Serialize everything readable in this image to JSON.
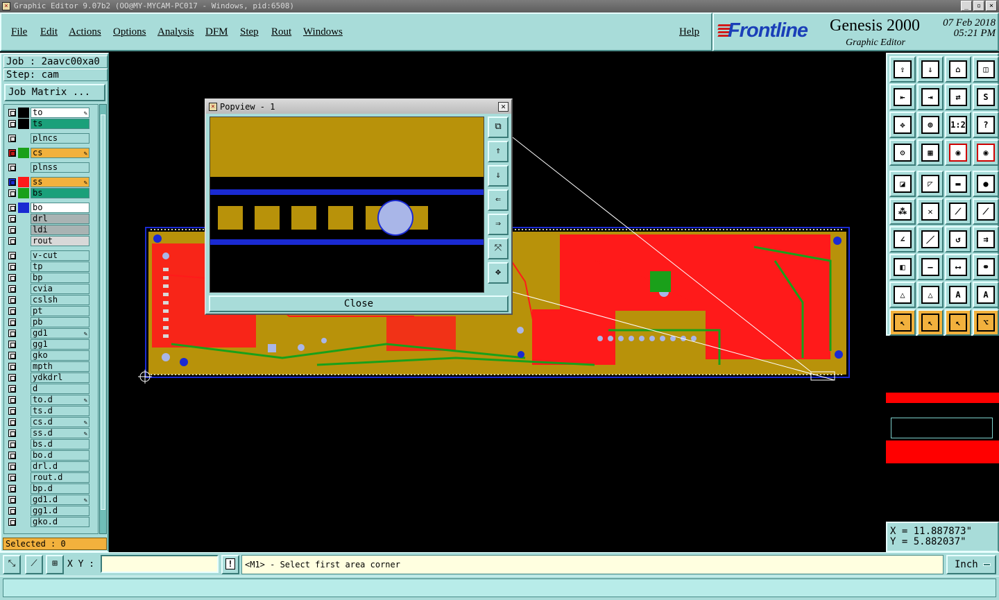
{
  "window": {
    "title": "Graphic Editor 9.07b2 (OO@MY-MYCAM-PC017 - Windows, pid:6508)",
    "controls": [
      "_",
      "▫",
      "×"
    ]
  },
  "menu": {
    "items": [
      "File",
      "Edit",
      "Actions",
      "Options",
      "Analysis",
      "DFM",
      "Step",
      "Rout",
      "Windows"
    ],
    "help": "Help"
  },
  "brand": {
    "logo": "Frontline",
    "product": "Genesis 2000",
    "subtitle": "Graphic Editor",
    "date": "07 Feb 2018",
    "time": "05:21 PM"
  },
  "job": {
    "job_label": "Job : 2aavc00xa0",
    "step_label": "Step: cam",
    "matrix_button": "Job Matrix ..."
  },
  "layers": [
    {
      "name": "to",
      "swatch": "#000000",
      "bg": "#ffffff",
      "edit": "✎"
    },
    {
      "name": "ts",
      "swatch": "#000000",
      "bg": "#1aa07a",
      "edit": ""
    },
    {
      "name": "plncs",
      "swatch": "",
      "bg": "#a8dcd9",
      "edit": ""
    },
    {
      "name": "cs",
      "swatch": "#1aa01a",
      "bg": "#f2b13d",
      "edit": "✎",
      "checked": true
    },
    {
      "name": "plnss",
      "swatch": "",
      "bg": "#a8dcd9",
      "edit": ""
    },
    {
      "name": "ss",
      "swatch": "#ff1a1a",
      "bg": "#f2b13d",
      "edit": "✎",
      "checked": true,
      "active": true
    },
    {
      "name": "bs",
      "swatch": "#1aa01a",
      "bg": "#1aa07a",
      "edit": ""
    },
    {
      "name": "bo",
      "swatch": "#1a2ad2",
      "bg": "#ffffff",
      "edit": ""
    },
    {
      "name": "drl",
      "swatch": "",
      "bg": "#a9b3b3",
      "edit": ""
    },
    {
      "name": "ldi",
      "swatch": "",
      "bg": "#a9b3b3",
      "edit": ""
    },
    {
      "name": "rout",
      "swatch": "",
      "bg": "#d8d8d8",
      "edit": ""
    },
    {
      "name": "v-cut",
      "swatch": "",
      "bg": "#a8dcd9",
      "edit": ""
    },
    {
      "name": "tp",
      "swatch": "",
      "bg": "#a8dcd9",
      "edit": ""
    },
    {
      "name": "bp",
      "swatch": "",
      "bg": "#a8dcd9",
      "edit": ""
    },
    {
      "name": "cvia",
      "swatch": "",
      "bg": "#a8dcd9",
      "edit": ""
    },
    {
      "name": "cslsh",
      "swatch": "",
      "bg": "#a8dcd9",
      "edit": ""
    },
    {
      "name": "pt",
      "swatch": "",
      "bg": "#a8dcd9",
      "edit": ""
    },
    {
      "name": "pb",
      "swatch": "",
      "bg": "#a8dcd9",
      "edit": ""
    },
    {
      "name": "gd1",
      "swatch": "",
      "bg": "#a8dcd9",
      "edit": "✎"
    },
    {
      "name": "gg1",
      "swatch": "",
      "bg": "#a8dcd9",
      "edit": ""
    },
    {
      "name": "gko",
      "swatch": "",
      "bg": "#a8dcd9",
      "edit": ""
    },
    {
      "name": "mpth",
      "swatch": "",
      "bg": "#a8dcd9",
      "edit": ""
    },
    {
      "name": "ydkdrl",
      "swatch": "",
      "bg": "#a8dcd9",
      "edit": ""
    },
    {
      "name": "d",
      "swatch": "",
      "bg": "#a8dcd9",
      "edit": ""
    },
    {
      "name": "to.d",
      "swatch": "",
      "bg": "#a8dcd9",
      "edit": "✎"
    },
    {
      "name": "ts.d",
      "swatch": "",
      "bg": "#a8dcd9",
      "edit": ""
    },
    {
      "name": "cs.d",
      "swatch": "",
      "bg": "#a8dcd9",
      "edit": "✎"
    },
    {
      "name": "ss.d",
      "swatch": "",
      "bg": "#a8dcd9",
      "edit": "✎"
    },
    {
      "name": "bs.d",
      "swatch": "",
      "bg": "#a8dcd9",
      "edit": ""
    },
    {
      "name": "bo.d",
      "swatch": "",
      "bg": "#a8dcd9",
      "edit": ""
    },
    {
      "name": "drl.d",
      "swatch": "",
      "bg": "#a8dcd9",
      "edit": ""
    },
    {
      "name": "rout.d",
      "swatch": "",
      "bg": "#a8dcd9",
      "edit": ""
    },
    {
      "name": "bp.d",
      "swatch": "",
      "bg": "#a8dcd9",
      "edit": ""
    },
    {
      "name": "gd1.d",
      "swatch": "",
      "bg": "#a8dcd9",
      "edit": "✎"
    },
    {
      "name": "gg1.d",
      "swatch": "",
      "bg": "#a8dcd9",
      "edit": ""
    },
    {
      "name": "gko.d",
      "swatch": "",
      "bg": "#a8dcd9",
      "edit": ""
    }
  ],
  "selected": "Selected : 0",
  "popview": {
    "title": "Popview - 1",
    "close_label": "Close",
    "tools": [
      "zoom-window",
      "pan-up",
      "pan-down",
      "pan-left",
      "pan-right",
      "zoom-fit",
      "zoom-home"
    ]
  },
  "toolbar": [
    "zoom-home-icon",
    "zoom-in-icon",
    "home-icon",
    "split-window-icon",
    "pan-left-icon",
    "pan-right-icon",
    "mirror-icon",
    "s-curve-icon",
    "fit-icon",
    "center-icon",
    "scale-1-2-icon",
    "help-icon",
    "settings-icon",
    "grid-icon",
    "snap-pad-icon",
    "snap-pad-alt-icon",
    "select-icon",
    "measure-angle-icon",
    "ruler-icon",
    "pad-select-icon",
    "connect-icon",
    "cross-icon",
    "line-red-icon",
    "line-blue-icon",
    "angle-icon",
    "slash-icon",
    "arc-icon",
    "arrow-icon",
    "feature-icon",
    "line-dash-icon",
    "ruler-span-icon",
    "group-icon",
    "triangle-red-icon",
    "triangle-blue-icon",
    "triangle-a-icon",
    "triangle-alt-icon",
    "pointer-icon",
    "pointer-box-icon",
    "pointer-dot-icon",
    "route-icon"
  ],
  "coords": {
    "x": "X = 11.887873\"",
    "y": "Y = 5.882037\""
  },
  "bottom": {
    "xy_label": "X Y :",
    "xy_value": "",
    "warn": "!",
    "prompt": "<M1> - Select first area corner",
    "unit": "Inch"
  },
  "colors": {
    "panel": "#a8dcd9",
    "copper": "#b8920a",
    "red_layer": "#ff1a1a",
    "green_layer": "#1aa01a",
    "drill": "#a9b6e8",
    "blue": "#1a2ad2"
  }
}
